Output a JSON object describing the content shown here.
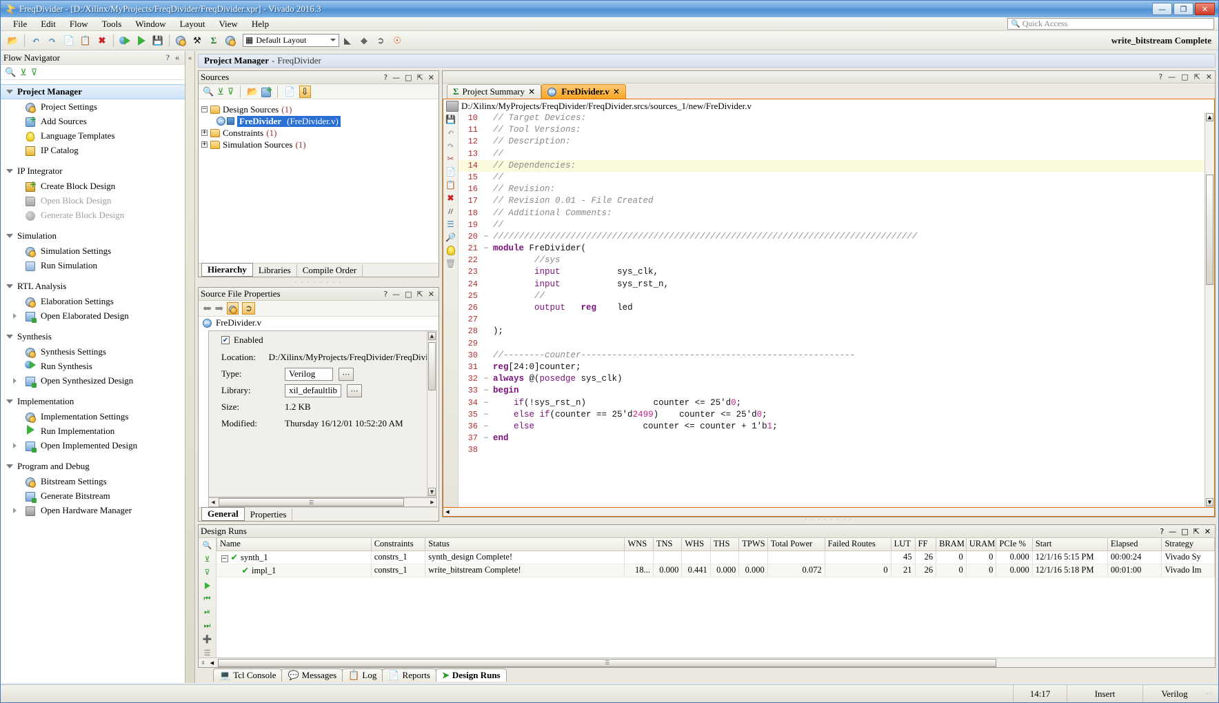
{
  "window": {
    "title": "FreqDivider - [D:/Xilinx/MyProjects/FreqDivider/FreqDivider.xpr] - Vivado 2016.3",
    "minimize": "—",
    "maximize": "❐",
    "close": "✕"
  },
  "menubar": {
    "items": [
      "File",
      "Edit",
      "Flow",
      "Tools",
      "Window",
      "Layout",
      "View",
      "Help"
    ]
  },
  "search": {
    "placeholder": "Quick Access",
    "icon": "search-icon"
  },
  "toolbar": {
    "layout_combo": "Default Layout",
    "status_text": "write_bitstream Complete",
    "icons": [
      "open-project-icon",
      "undo-icon",
      "redo-icon",
      "copy-icon",
      "paste-icon",
      "delete-icon",
      "run-synthesis-icon",
      "run-implementation-icon",
      "generate-bitstream-icon",
      "settings-icon",
      "tools-icon",
      "report-icon",
      "program-device-icon",
      "filter-icon",
      "marker-icon",
      "pointer-icon",
      "help-icon"
    ]
  },
  "flow_navigator": {
    "title": "Flow Navigator",
    "help_glyph": "?",
    "collapse_glyph": "«",
    "toolbar_icons": [
      "search-icon",
      "collapse-all-icon",
      "expand-all-icon"
    ],
    "sections": [
      {
        "label": "Project Manager",
        "selected": true,
        "items": [
          {
            "label": "Project Settings",
            "icon": "gear-icon",
            "disabled": false,
            "expandable": false
          },
          {
            "label": "Add Sources",
            "icon": "add-sources-icon",
            "disabled": false,
            "expandable": false
          },
          {
            "label": "Language Templates",
            "icon": "bulb-icon",
            "disabled": false,
            "expandable": false
          },
          {
            "label": "IP Catalog",
            "icon": "ip-catalog-icon",
            "disabled": false,
            "expandable": false
          }
        ]
      },
      {
        "label": "IP Integrator",
        "selected": false,
        "items": [
          {
            "label": "Create Block Design",
            "icon": "create-block-design-icon",
            "disabled": false,
            "expandable": false
          },
          {
            "label": "Open Block Design",
            "icon": "open-block-design-icon",
            "disabled": true,
            "expandable": false
          },
          {
            "label": "Generate Block Design",
            "icon": "generate-block-design-icon",
            "disabled": true,
            "expandable": false
          }
        ]
      },
      {
        "label": "Simulation",
        "selected": false,
        "items": [
          {
            "label": "Simulation Settings",
            "icon": "gear-icon",
            "disabled": false,
            "expandable": false
          },
          {
            "label": "Run Simulation",
            "icon": "waveform-icon",
            "disabled": false,
            "expandable": false
          }
        ]
      },
      {
        "label": "RTL Analysis",
        "selected": false,
        "items": [
          {
            "label": "Elaboration Settings",
            "icon": "gear-icon",
            "disabled": false,
            "expandable": false
          },
          {
            "label": "Open Elaborated Design",
            "icon": "open-design-icon",
            "disabled": false,
            "expandable": true
          }
        ]
      },
      {
        "label": "Synthesis",
        "selected": false,
        "items": [
          {
            "label": "Synthesis Settings",
            "icon": "gear-icon",
            "disabled": false,
            "expandable": false
          },
          {
            "label": "Run Synthesis",
            "icon": "run-synthesis-icon",
            "disabled": false,
            "expandable": false
          },
          {
            "label": "Open Synthesized Design",
            "icon": "open-design-icon",
            "disabled": false,
            "expandable": true
          }
        ]
      },
      {
        "label": "Implementation",
        "selected": false,
        "items": [
          {
            "label": "Implementation Settings",
            "icon": "gear-icon",
            "disabled": false,
            "expandable": false
          },
          {
            "label": "Run Implementation",
            "icon": "play-icon",
            "disabled": false,
            "expandable": false
          },
          {
            "label": "Open Implemented Design",
            "icon": "open-design-icon",
            "disabled": false,
            "expandable": true
          }
        ]
      },
      {
        "label": "Program and Debug",
        "selected": false,
        "items": [
          {
            "label": "Bitstream Settings",
            "icon": "gear-icon",
            "disabled": false,
            "expandable": false
          },
          {
            "label": "Generate Bitstream",
            "icon": "generate-bitstream-icon",
            "disabled": false,
            "expandable": false
          },
          {
            "label": "Open Hardware Manager",
            "icon": "hardware-manager-icon",
            "disabled": false,
            "expandable": true
          }
        ]
      }
    ]
  },
  "project_manager": {
    "title": "Project Manager",
    "separator": "-",
    "project_name": "FreqDivider"
  },
  "sources_panel": {
    "title": "Sources",
    "window_buttons": [
      "?",
      "—",
      "□",
      "⇱",
      "✕"
    ],
    "toolbar_icons": [
      "search-icon",
      "collapse-all-icon",
      "expand-all-icon",
      "open-file-icon",
      "add-sources-icon",
      "report-icon",
      "hierarchy-update-icon"
    ],
    "tree": [
      {
        "label": "Design Sources",
        "count": "(1)",
        "expander": "−",
        "type": "folder",
        "selected": false
      },
      {
        "label": "FreDivider",
        "paren": "(FreDivider.v)",
        "type": "verilog",
        "selected": true
      },
      {
        "label": "Constraints",
        "count": "(1)",
        "expander": "+",
        "type": "folder",
        "selected": false
      },
      {
        "label": "Simulation Sources",
        "count": "(1)",
        "expander": "+",
        "type": "folder",
        "selected": false
      }
    ],
    "tabs": [
      {
        "label": "Hierarchy",
        "active": true
      },
      {
        "label": "Libraries",
        "active": false
      },
      {
        "label": "Compile Order",
        "active": false
      }
    ]
  },
  "properties_panel": {
    "title": "Source File Properties",
    "window_buttons": [
      "?",
      "—",
      "□",
      "⇱",
      "✕"
    ],
    "toolbar_icons": [
      "back-arrow-icon",
      "forward-arrow-icon",
      "properties-icon",
      "select-icon"
    ],
    "file_name": "FreDivider.v",
    "enabled_label": "Enabled",
    "enabled_checked": true,
    "rows": [
      {
        "label": "Location:",
        "value": "D:/Xilinx/MyProjects/FreqDivider/FreqDivide",
        "boxed": false,
        "has_dots": false
      },
      {
        "label": "Type:",
        "value": "Verilog",
        "boxed": true,
        "has_dots": true
      },
      {
        "label": "Library:",
        "value": "xil_defaultlib",
        "boxed": true,
        "has_dots": true
      },
      {
        "label": "Size:",
        "value": "1.2 KB",
        "boxed": false,
        "has_dots": false
      },
      {
        "label": "Modified:",
        "value": "Thursday 16/12/01 10:52:20 AM",
        "boxed": false,
        "has_dots": false
      }
    ],
    "tabs": [
      {
        "label": "General",
        "active": true
      },
      {
        "label": "Properties",
        "active": false
      }
    ]
  },
  "editor": {
    "window_buttons": [
      "?",
      "—",
      "□",
      "⇱",
      "✕"
    ],
    "tabs": [
      {
        "label": "Project Summary",
        "icon": "sigma-icon",
        "active": false,
        "closable": true
      },
      {
        "label": "FreDivider.v",
        "icon": "verilog-icon",
        "active": true,
        "closable": true
      }
    ],
    "path": "D:/Xilinx/MyProjects/FreqDivider/FreqDivider.srcs/sources_1/new/FreDivider.v",
    "gutter_icons": [
      "save-icon",
      "undo-icon",
      "redo-icon",
      "cut-icon",
      "copy-icon",
      "paste-icon",
      "delete-icon",
      "comment-icon",
      "indent-icon",
      "find-icon",
      "bulb-icon",
      "trash-icon"
    ],
    "lines": [
      {
        "num": "10",
        "fold": "",
        "highlight": false,
        "tokens": [
          {
            "t": "// Target Devices:",
            "c": "comment"
          }
        ]
      },
      {
        "num": "11",
        "fold": "",
        "highlight": false,
        "tokens": [
          {
            "t": "// Tool Versions:",
            "c": "comment"
          }
        ]
      },
      {
        "num": "12",
        "fold": "",
        "highlight": false,
        "tokens": [
          {
            "t": "// Description:",
            "c": "comment"
          }
        ]
      },
      {
        "num": "13",
        "fold": "",
        "highlight": false,
        "tokens": [
          {
            "t": "//",
            "c": "comment"
          }
        ]
      },
      {
        "num": "14",
        "fold": "",
        "highlight": true,
        "tokens": [
          {
            "t": "// Dependencies:",
            "c": "comment"
          }
        ]
      },
      {
        "num": "15",
        "fold": "",
        "highlight": false,
        "tokens": [
          {
            "t": "//",
            "c": "comment"
          }
        ]
      },
      {
        "num": "16",
        "fold": "",
        "highlight": false,
        "tokens": [
          {
            "t": "// Revision:",
            "c": "comment"
          }
        ]
      },
      {
        "num": "17",
        "fold": "",
        "highlight": false,
        "tokens": [
          {
            "t": "// Revision 0.01 - File Created",
            "c": "comment"
          }
        ]
      },
      {
        "num": "18",
        "fold": "",
        "highlight": false,
        "tokens": [
          {
            "t": "// Additional Comments:",
            "c": "comment"
          }
        ]
      },
      {
        "num": "19",
        "fold": "",
        "highlight": false,
        "tokens": [
          {
            "t": "//",
            "c": "comment"
          }
        ]
      },
      {
        "num": "20",
        "fold": "−",
        "highlight": false,
        "tokens": [
          {
            "t": "//////////////////////////////////////////////////////////////////////////////////",
            "c": "comment"
          }
        ]
      },
      {
        "num": "21",
        "fold": "−",
        "highlight": false,
        "tokens": [
          {
            "t": "module",
            "c": "kw"
          },
          {
            "t": " FreDivider(",
            "c": "plain"
          }
        ]
      },
      {
        "num": "22",
        "fold": "",
        "highlight": false,
        "tokens": [
          {
            "t": "        //sys",
            "c": "comment"
          }
        ]
      },
      {
        "num": "23",
        "fold": "",
        "highlight": false,
        "tokens": [
          {
            "t": "        input",
            "c": "kw2"
          },
          {
            "t": "           sys_clk,",
            "c": "plain"
          }
        ]
      },
      {
        "num": "24",
        "fold": "",
        "highlight": false,
        "tokens": [
          {
            "t": "        input",
            "c": "kw2"
          },
          {
            "t": "           sys_rst_n,",
            "c": "plain"
          }
        ]
      },
      {
        "num": "25",
        "fold": "",
        "highlight": false,
        "tokens": [
          {
            "t": "        //",
            "c": "comment"
          }
        ]
      },
      {
        "num": "26",
        "fold": "",
        "highlight": false,
        "tokens": [
          {
            "t": "        output",
            "c": "kw2"
          },
          {
            "t": "   ",
            "c": "plain"
          },
          {
            "t": "reg",
            "c": "kw"
          },
          {
            "t": "    led",
            "c": "plain"
          }
        ]
      },
      {
        "num": "27",
        "fold": "",
        "highlight": false,
        "tokens": [
          {
            "t": "",
            "c": "plain"
          }
        ]
      },
      {
        "num": "28",
        "fold": "",
        "highlight": false,
        "tokens": [
          {
            "t": ");",
            "c": "plain"
          }
        ]
      },
      {
        "num": "29",
        "fold": "",
        "highlight": false,
        "tokens": [
          {
            "t": "",
            "c": "plain"
          }
        ]
      },
      {
        "num": "30",
        "fold": "",
        "highlight": false,
        "tokens": [
          {
            "t": "//--------counter-----------------------------------------------------",
            "c": "comment"
          }
        ]
      },
      {
        "num": "31",
        "fold": "",
        "highlight": false,
        "tokens": [
          {
            "t": "reg",
            "c": "kw"
          },
          {
            "t": "[24:0]counter;",
            "c": "plain"
          }
        ]
      },
      {
        "num": "32",
        "fold": "−",
        "highlight": false,
        "tokens": [
          {
            "t": "always",
            "c": "kw"
          },
          {
            "t": " @(",
            "c": "plain"
          },
          {
            "t": "posedge",
            "c": "kw2"
          },
          {
            "t": " sys_clk)",
            "c": "plain"
          }
        ]
      },
      {
        "num": "33",
        "fold": "−",
        "highlight": false,
        "tokens": [
          {
            "t": "begin",
            "c": "kw"
          }
        ]
      },
      {
        "num": "34",
        "fold": "−",
        "highlight": false,
        "tokens": [
          {
            "t": "    ",
            "c": "plain"
          },
          {
            "t": "if",
            "c": "kw2"
          },
          {
            "t": "(!sys_rst_n)             counter <= 25'd",
            "c": "plain"
          },
          {
            "t": "0",
            "c": "num"
          },
          {
            "t": ";",
            "c": "plain"
          }
        ]
      },
      {
        "num": "35",
        "fold": "−",
        "highlight": false,
        "tokens": [
          {
            "t": "    ",
            "c": "plain"
          },
          {
            "t": "else if",
            "c": "kw2"
          },
          {
            "t": "(counter == 25'd",
            "c": "plain"
          },
          {
            "t": "2499",
            "c": "num"
          },
          {
            "t": ")    counter <= 25'd",
            "c": "plain"
          },
          {
            "t": "0",
            "c": "num"
          },
          {
            "t": ";",
            "c": "plain"
          }
        ]
      },
      {
        "num": "36",
        "fold": "−",
        "highlight": false,
        "tokens": [
          {
            "t": "    ",
            "c": "plain"
          },
          {
            "t": "else",
            "c": "kw2"
          },
          {
            "t": "                     counter <= counter + 1'b",
            "c": "plain"
          },
          {
            "t": "1",
            "c": "num"
          },
          {
            "t": ";",
            "c": "plain"
          }
        ]
      },
      {
        "num": "37",
        "fold": "−",
        "highlight": false,
        "tokens": [
          {
            "t": "end",
            "c": "kw"
          }
        ]
      },
      {
        "num": "38",
        "fold": "",
        "highlight": false,
        "tokens": [
          {
            "t": "",
            "c": "plain"
          }
        ]
      }
    ]
  },
  "design_runs": {
    "title": "Design Runs",
    "window_buttons": [
      "?",
      "—",
      "□",
      "⇱",
      "✕"
    ],
    "side_icons": [
      "search-icon",
      "collapse-all-icon",
      "expand-all-icon",
      "run-icon",
      "first-icon",
      "prev-icon",
      "next-icon",
      "add-icon",
      "sort-icon"
    ],
    "columns": [
      "Name",
      "Constraints",
      "Status",
      "WNS",
      "TNS",
      "WHS",
      "THS",
      "TPWS",
      "Total Power",
      "Failed Routes",
      "LUT",
      "FF",
      "BRAM",
      "URAM",
      "PCIe %",
      "Start",
      "Elapsed",
      "Strategy"
    ],
    "rows": [
      {
        "name": "synth_1",
        "indent": 0,
        "expander": "−",
        "check": "✔",
        "constraints": "constrs_1",
        "status": "synth_design Complete!",
        "wns": "",
        "tns": "",
        "whs": "",
        "ths": "",
        "tpws": "",
        "total_power": "",
        "failed_routes": "",
        "lut": "45",
        "ff": "26",
        "bram": "0",
        "uram": "0",
        "pcie": "0.000",
        "start": "12/1/16 5:15 PM",
        "elapsed": "00:00:24",
        "strategy": "Vivado Sy"
      },
      {
        "name": "impl_1",
        "indent": 1,
        "expander": "",
        "check": "✔",
        "constraints": "constrs_1",
        "status": "write_bitstream Complete!",
        "wns": "18...",
        "tns": "0.000",
        "whs": "0.441",
        "ths": "0.000",
        "tpws": "0.000",
        "total_power": "0.072",
        "failed_routes": "0",
        "lut": "21",
        "ff": "26",
        "bram": "0",
        "uram": "0",
        "pcie": "0.000",
        "start": "12/1/16 5:18 PM",
        "elapsed": "00:01:00",
        "strategy": "Vivado Im"
      }
    ],
    "bottom_tabs": [
      {
        "label": "Tcl Console",
        "icon": "console-icon",
        "active": false
      },
      {
        "label": "Messages",
        "icon": "message-icon",
        "active": false
      },
      {
        "label": "Log",
        "icon": "log-icon",
        "active": false
      },
      {
        "label": "Reports",
        "icon": "report-icon",
        "active": false
      },
      {
        "label": "Design Runs",
        "icon": "design-runs-icon",
        "active": true
      }
    ]
  },
  "statusbar": {
    "time": "14:17",
    "insert_mode": "Insert",
    "language": "Verilog",
    "grip": "⋰"
  }
}
